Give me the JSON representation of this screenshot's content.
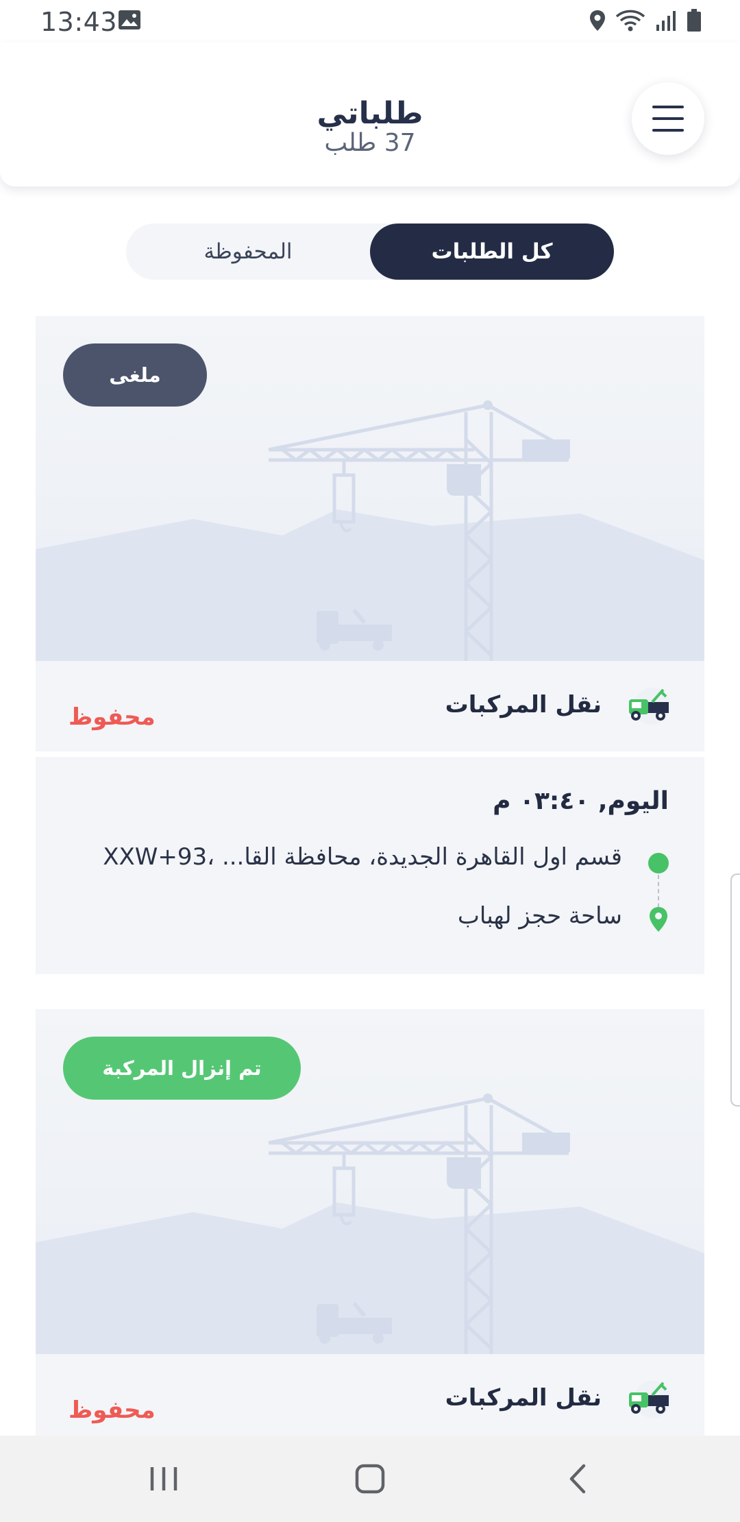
{
  "status_bar": {
    "time": "13:43",
    "icons": [
      "gallery-icon",
      "location-icon",
      "wifi-icon",
      "signal-icon",
      "battery-icon"
    ]
  },
  "header": {
    "title": "طلباتي",
    "subtitle": "37 طلب",
    "menu_icon": "hamburger-menu-icon"
  },
  "tabs": [
    {
      "label": "كل الطلبات",
      "active": true
    },
    {
      "label": "المحفوظة",
      "active": false
    }
  ],
  "orders": [
    {
      "status": "ملغى",
      "status_color": "#4b546b",
      "service": "نقل المركبات",
      "saved_label": "محفوظ",
      "date": "اليوم, ٠٣:٤٠ م",
      "from": "قسم اول القاهرة الجديدة، محافظة القا... ،93+XXW",
      "to": "ساحة حجز لهباب"
    },
    {
      "status": "تم إنزال المركبة",
      "status_color": "#55c774",
      "service": "نقل المركبات",
      "saved_label": "محفوظ"
    }
  ],
  "colors": {
    "primary_dark": "#242c45",
    "saved_red": "#ef5a55",
    "green": "#47c266",
    "card_bg": "#f3f5f8"
  },
  "navbar": {
    "icons": [
      "recent-apps-icon",
      "home-icon",
      "back-icon"
    ]
  }
}
